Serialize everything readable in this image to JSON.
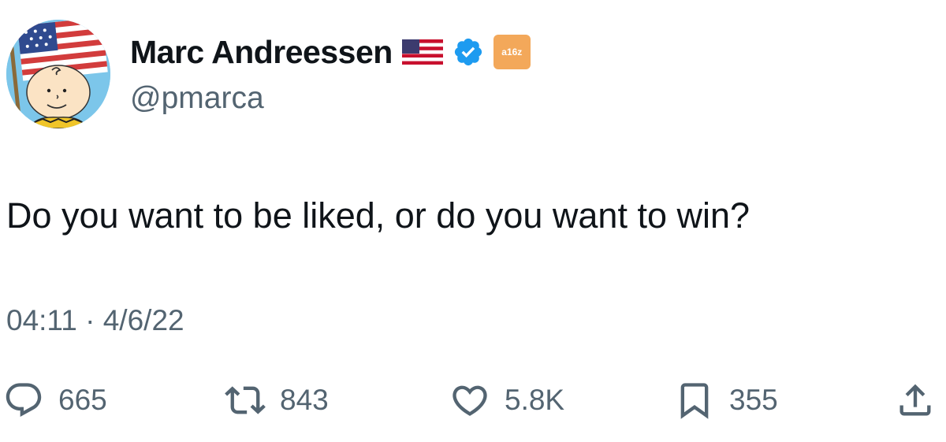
{
  "author": {
    "display_name": "Marc Andreessen",
    "handle": "@pmarca",
    "badges": [
      "us-flag-icon",
      "verified-icon",
      "affiliate-badge"
    ],
    "affiliate_label": "a16z"
  },
  "tweet": {
    "text": "Do you want to be liked, or do you want to win?",
    "timestamp": "04:11 · 4/6/22"
  },
  "actions": {
    "replies": "665",
    "retweets": "843",
    "likes": "5.8K",
    "bookmarks": "355"
  },
  "colors": {
    "text_primary": "#0f1419",
    "text_secondary": "#536471",
    "verified": "#1d9bf0",
    "affiliate": "#f3a85a"
  }
}
